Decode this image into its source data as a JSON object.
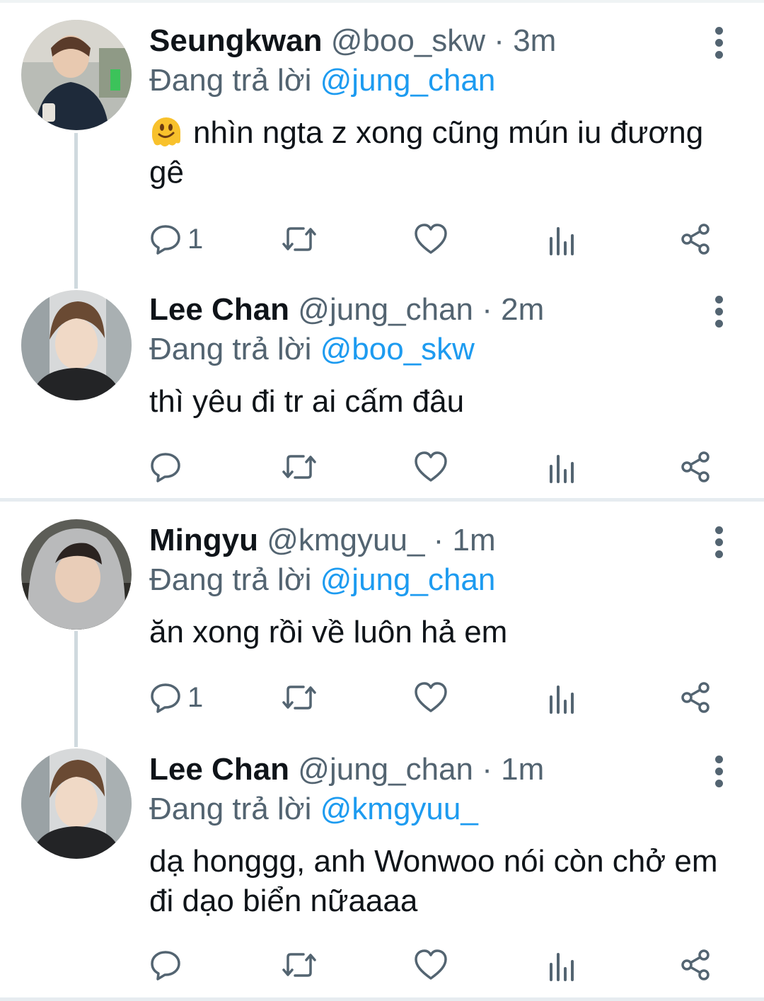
{
  "colors": {
    "text_primary": "#0f1419",
    "text_secondary": "#536471",
    "accent": "#1d9bf0",
    "divider": "#e6ecf0"
  },
  "reply_prefix": "Đang trả lời",
  "tweets": [
    {
      "name": "Seungkwan",
      "handle": "@boo_skw",
      "separator": "·",
      "time": "3m",
      "reply_to": "@jung_chan",
      "emoji": "melting-face-emoji",
      "text": "nhìn ngta z xong cũng mún iu đương gê",
      "reply_count": "1"
    },
    {
      "name": "Lee Chan",
      "handle": "@jung_chan",
      "separator": "·",
      "time": "2m",
      "reply_to": "@boo_skw",
      "text": "thì yêu đi tr ai cấm đâu",
      "reply_count": ""
    },
    {
      "name": "Mingyu",
      "handle": "@kmgyuu_",
      "separator": "·",
      "time": "1m",
      "reply_to": "@jung_chan",
      "text": "ăn xong rồi về luôn hả em",
      "reply_count": "1"
    },
    {
      "name": "Lee Chan",
      "handle": "@jung_chan",
      "separator": "·",
      "time": "1m",
      "reply_to": "@kmgyuu_",
      "text": "dạ honggg, anh Wonwoo nói còn chở em đi dạo biển nữaaaa",
      "reply_count": ""
    }
  ],
  "action_icons": [
    "reply-icon",
    "retweet-icon",
    "like-icon",
    "analytics-icon",
    "share-icon"
  ]
}
